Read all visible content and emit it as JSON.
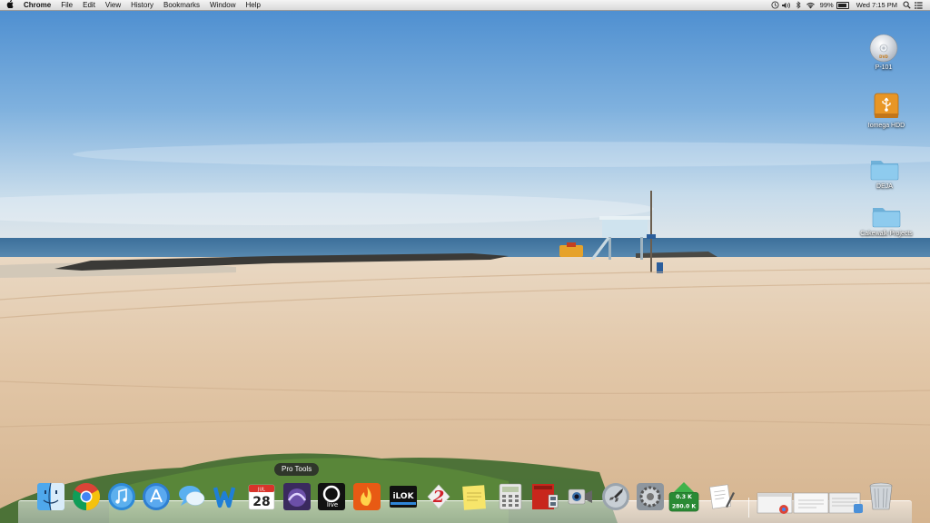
{
  "menubar": {
    "apple_icon": "apple-icon",
    "app_name": "Chrome",
    "menus": [
      "File",
      "Edit",
      "View",
      "History",
      "Bookmarks",
      "Window",
      "Help"
    ],
    "status": {
      "icons": [
        "time-machine-icon",
        "volume-icon",
        "bluetooth-icon",
        "wifi-icon"
      ],
      "battery_percent": "99%",
      "clock": "Wed 7:15 PM",
      "spotlight_icon": "spotlight-search-icon",
      "notification_icon": "notification-center-icon"
    }
  },
  "desktop": {
    "icons": [
      {
        "label": "P-101",
        "icon": "dvd-disc-icon"
      },
      {
        "label": "Iomega HDD",
        "icon": "usb-drive-icon"
      },
      {
        "label": "DEJA",
        "icon": "folder-icon"
      },
      {
        "label": "Cakewalk Projects",
        "icon": "folder-icon"
      }
    ]
  },
  "dock": {
    "tooltip": "Pro Tools",
    "apps": [
      "finder",
      "chrome",
      "itunes",
      "app-store",
      "messages",
      "word",
      "calendar",
      "pro-tools",
      "ableton-live",
      "burn",
      "ilok",
      "app-2",
      "stickies",
      "calculator",
      "photo-booth",
      "facetime-camera",
      "launchpad",
      "system-preferences",
      "network-monitor",
      "preview"
    ],
    "calendar": {
      "month": "JUL",
      "day": "28"
    },
    "network_monitor": {
      "upload": "0.3 K",
      "download": "280.0 K"
    },
    "minimized_windows": [
      "window-thumbnail-1",
      "window-thumbnail-2",
      "window-thumbnail-3"
    ],
    "trash": "trash-icon"
  }
}
